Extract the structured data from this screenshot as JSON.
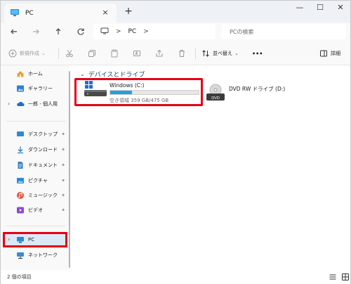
{
  "window": {
    "tab_title": "PC",
    "tab_close": "×",
    "new_tab": "+",
    "minimize": "—",
    "maximize": "☐",
    "close": "✕"
  },
  "address": {
    "separator": ">",
    "crumb": "PC",
    "trailing_separator": ">",
    "search_placeholder": "PCの検索"
  },
  "commandbar": {
    "new_label": "新規作成",
    "sort_label": "並べ替え",
    "more_label": "•••",
    "details_label": "詳細"
  },
  "sidebar": {
    "items": [
      {
        "label": "ホーム",
        "icon": "home-icon"
      },
      {
        "label": "ギャラリー",
        "icon": "gallery-icon"
      },
      {
        "label": "一郎 - 個人用",
        "icon": "cloud-icon"
      },
      {
        "label": "デスクトップ",
        "icon": "desktop-icon",
        "pin": "📌"
      },
      {
        "label": "ダウンロード",
        "icon": "download-icon",
        "pin": "📌"
      },
      {
        "label": "ドキュメント",
        "icon": "document-icon",
        "pin": "📌"
      },
      {
        "label": "ピクチャ",
        "icon": "pictures-icon",
        "pin": "📌"
      },
      {
        "label": "ミュージック",
        "icon": "music-icon",
        "pin": "📌"
      },
      {
        "label": "ビデオ",
        "icon": "video-icon",
        "pin": "📌"
      },
      {
        "label": "PC",
        "icon": "pc-icon"
      },
      {
        "label": "ネットワーク",
        "icon": "network-icon"
      }
    ]
  },
  "main": {
    "section_title": "デバイスとドライブ",
    "drives": [
      {
        "name": "Windows (C:)",
        "space": "空き領域 359 GB/475 GB",
        "used_fraction": 0.244
      },
      {
        "name": "DVD RW ドライブ (D:)",
        "badge": "DVD"
      }
    ]
  },
  "status": {
    "item_count": "2 個の項目"
  },
  "colors": {
    "accent": "#26a0da",
    "highlight": "#e60012",
    "selected": "#dbe9f7"
  }
}
